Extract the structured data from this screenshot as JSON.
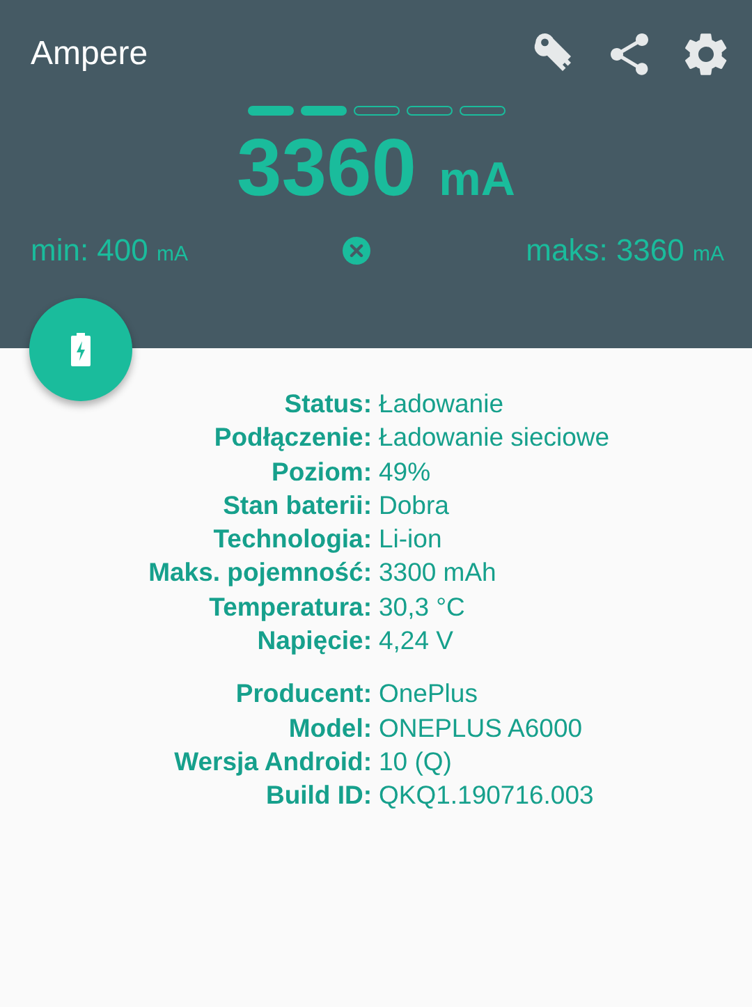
{
  "app_bar": {
    "title": "Ampere"
  },
  "meter": {
    "segments": [
      {
        "on": true
      },
      {
        "on": true
      },
      {
        "on": false
      },
      {
        "on": false
      },
      {
        "on": false
      }
    ]
  },
  "current": {
    "value": "3360",
    "unit": "mA"
  },
  "min": {
    "label": "min:",
    "value": "400",
    "unit": "mA"
  },
  "max": {
    "label": "maks:",
    "value": "3360",
    "unit": "mA"
  },
  "info_groups": [
    {
      "rows": [
        {
          "label": "Status:",
          "value": "Ładowanie"
        },
        {
          "label": "Podłączenie:",
          "value": "Ładowanie sieciowe"
        },
        {
          "label": "Poziom:",
          "value": "49%"
        },
        {
          "label": "Stan baterii:",
          "value": "Dobra"
        },
        {
          "label": "Technologia:",
          "value": "Li-ion"
        },
        {
          "label": "Maks. pojemność:",
          "value": "3300 mAh"
        },
        {
          "label": "Temperatura:",
          "value": "30,3 °C"
        },
        {
          "label": "Napięcie:",
          "value": "4,24 V"
        }
      ]
    },
    {
      "rows": [
        {
          "label": "Producent:",
          "value": "OnePlus"
        },
        {
          "label": "Model:",
          "value": "ONEPLUS A6000"
        },
        {
          "label": "Wersja Android:",
          "value": "10 (Q)"
        },
        {
          "label": "Build ID:",
          "value": "QKQ1.190716.003"
        }
      ]
    }
  ]
}
